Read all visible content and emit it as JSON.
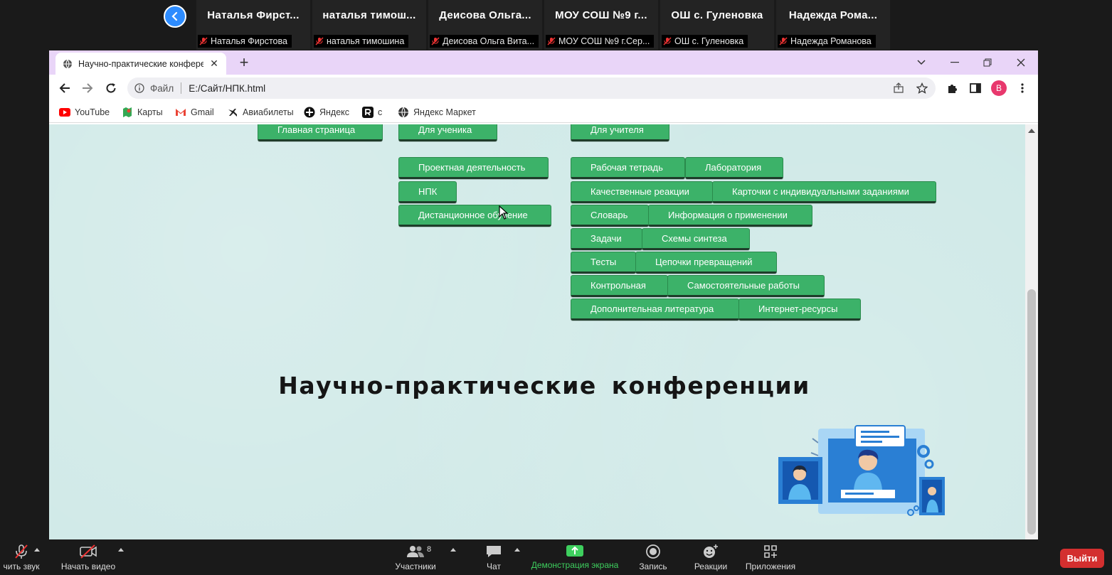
{
  "zoom": {
    "participants": [
      {
        "name": "Наталья  Фирст...",
        "label": "Наталья Фирстова"
      },
      {
        "name": "наталья  тимош...",
        "label": "наталья тимошина"
      },
      {
        "name": "Деисова  Ольга...",
        "label": "Деисова Ольга Вита..."
      },
      {
        "name": "МОУ  СОШ  №9  г...",
        "label": "МОУ СОШ №9 г.Сер..."
      },
      {
        "name": "ОШ  с.  Гуленовка",
        "label": "ОШ с. Гуленовка"
      },
      {
        "name": "Надежда  Рома...",
        "label": "Надежда Романова"
      }
    ],
    "toolbar": {
      "audio": "чить звук",
      "video": "Начать видео",
      "participants": "Участники",
      "participants_count": "8",
      "chat": "Чат",
      "share": "Демонстрация экрана",
      "record": "Запись",
      "reactions": "Реакции",
      "apps": "Приложения",
      "leave": "Выйти"
    }
  },
  "browser": {
    "tab_title": "Научно-практические конфере",
    "omnibox": {
      "scheme_label": "Файл",
      "url": "E:/Сайт/НПК.html"
    },
    "profile_initial": "B",
    "bookmarks": [
      "YouTube",
      "Карты",
      "Gmail",
      "Авиабилеты",
      "Яндекс",
      "с",
      "Яндекс Маркет"
    ]
  },
  "page": {
    "nav": {
      "main": "Главная страница",
      "student": "Для ученика",
      "teacher": "Для учителя"
    },
    "student_menu": [
      "Проектная деятельность",
      "НПК",
      "Дистанционное обучение"
    ],
    "teacher_menu": [
      [
        "Рабочая тетрадь",
        "Лаборатория"
      ],
      [
        "Качественные реакции",
        "Карточки с индивидуальными заданиями"
      ],
      [
        "Словарь",
        "Информация о применении"
      ],
      [
        "Задачи",
        "Схемы синтеза"
      ],
      [
        "Тесты",
        "Цепочки превращений"
      ],
      [
        "Контрольная",
        "Самостоятельные работы"
      ],
      [
        "Дополнительная литература",
        "Интернет-ресурсы"
      ]
    ],
    "title": "Научно-практические  конференции"
  },
  "colors": {
    "button_green": "#3cb269",
    "page_bg": "#cde8e6",
    "tabbar": "#e9d5f8",
    "zoom_blue": "#2d8cff",
    "leave_red": "#d32f2f"
  }
}
